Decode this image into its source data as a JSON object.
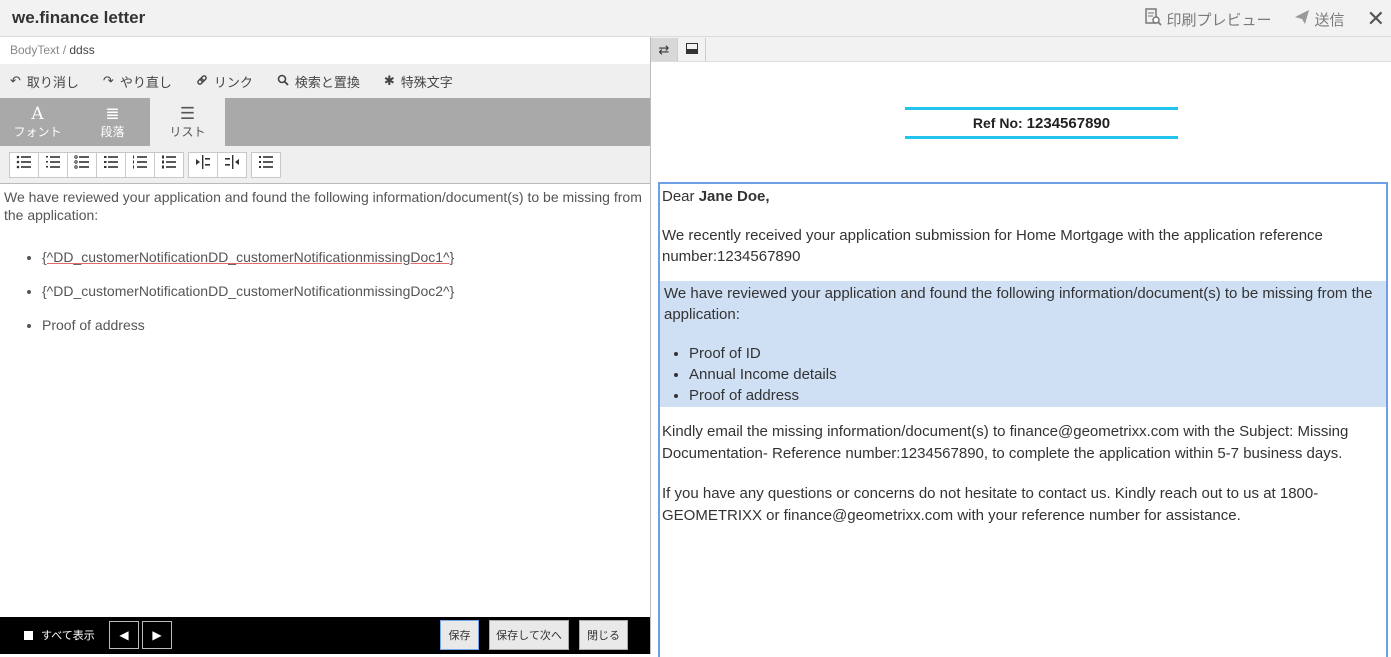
{
  "app": {
    "title": "we.finance letter",
    "print_preview": "印刷プレビュー",
    "send": "送信",
    "close_glyph": "✕"
  },
  "breadcrumb": {
    "parent": "BodyText /",
    "current": "ddss"
  },
  "toolbar": {
    "undo": "取り消し",
    "redo": "やり直し",
    "link": "リンク",
    "find_replace": "検索と置換",
    "special_chars": "特殊文字"
  },
  "tabs": [
    {
      "label": "フォント",
      "glyph": "A"
    },
    {
      "label": "段落",
      "glyph": "≣"
    },
    {
      "label": "リスト",
      "glyph": "☰"
    }
  ],
  "editor": {
    "intro": "We have reviewed your application and found the following information/document(s) to be missing from the application:",
    "items": [
      "{^DD_customerNotificationDD_customerNotificationmissingDoc1^}",
      "{^DD_customerNotificationDD_customerNotificationmissingDoc2^}",
      "Proof of address"
    ]
  },
  "footer": {
    "show_all": "すべて表示",
    "save": "保存",
    "save_next": "保存して次へ",
    "close": "閉じる"
  },
  "preview": {
    "ref_label": "Ref No:",
    "ref_number": "1234567890",
    "dear": "Dear",
    "name": "Jane Doe,",
    "p1": "We recently received your application submission for Home Mortgage with the application reference number:1234567890",
    "p2": "We have reviewed your application and found the following information/document(s) to be missing from the application:",
    "items": [
      "Proof of ID",
      "Annual Income details",
      "Proof of address"
    ],
    "p3": "Kindly email the missing information/document(s) to finance@geometrixx.com with the Subject: Missing Documentation- Reference number:1234567890, to complete the application within 5-7 business days.",
    "p4": "If you have any questions or concerns do not hesitate to contact us. Kindly reach out to us at 1800-GEOMETRIXX or finance@geometrixx.com with your reference number for assistance."
  }
}
